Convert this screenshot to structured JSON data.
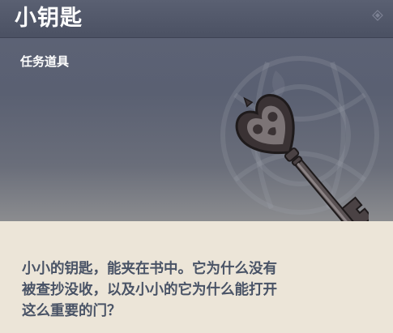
{
  "item": {
    "name": "小钥匙",
    "type": "任务道具",
    "description": "小小的钥匙，能夹在书中。它为什么没有\n被查抄没收，以及小小的它为什么能打开\n这么重要的门？",
    "icon": "key-icon"
  },
  "colors": {
    "header": "#4f5568",
    "banner_top": "#5c6275",
    "banner_bottom": "#8b8c8f",
    "description_bg": "#ece5d8",
    "description_text": "#495366"
  }
}
